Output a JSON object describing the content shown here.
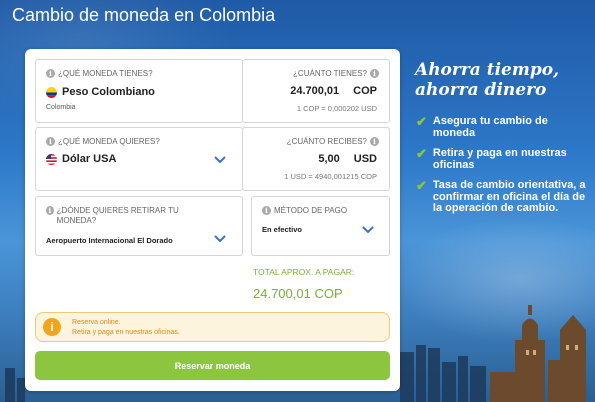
{
  "page": {
    "title": "Cambio de moneda en Colombia"
  },
  "have": {
    "label": "¿QUÉ MONEDA TIENES?",
    "currency": "Peso Colombiano",
    "country": "Colombia",
    "amount_label": "¿CUÁNTO TIENES?",
    "amount": "24.700,01",
    "code": "COP",
    "rate": "1 COP = 0,000202 USD"
  },
  "want": {
    "label": "¿QUÉ MONEDA QUIERES?",
    "currency": "Dólar USA",
    "amount_label": "¿CUÁNTO RECIBES?",
    "amount": "5,00",
    "code": "USD",
    "rate": "1 USD = 4940,001215 COP"
  },
  "pickup": {
    "label": "¿DÓNDE QUIERES RETIRAR TU MONEDA?",
    "value": "Aeropuerto Internacional El Dorado"
  },
  "payment": {
    "label": "MÉTODO DE PAGO",
    "value": "En efectivo"
  },
  "total": {
    "label": "TOTAL APROX. A PAGAR:",
    "value": "24.700,01 COP"
  },
  "notice": {
    "line1": "Reserva online.",
    "line2": "Retira y paga en nuestras oficinas."
  },
  "reserve_button": "Reservar moneda",
  "promo": {
    "title_line1": "Ahorra tiempo,",
    "title_line2": "ahorra dinero",
    "items": [
      "Asegura tu cambio de moneda",
      "Retira y paga en nuestras oficinas",
      "Tasa de cambio orientativa, a confirmar en oficina el día de la operación de cambio."
    ]
  },
  "colors": {
    "accent_green": "#8cc63f",
    "total_green": "#7ab033",
    "chevron_blue": "#3a73c4",
    "notice_orange": "#f2a41f"
  }
}
